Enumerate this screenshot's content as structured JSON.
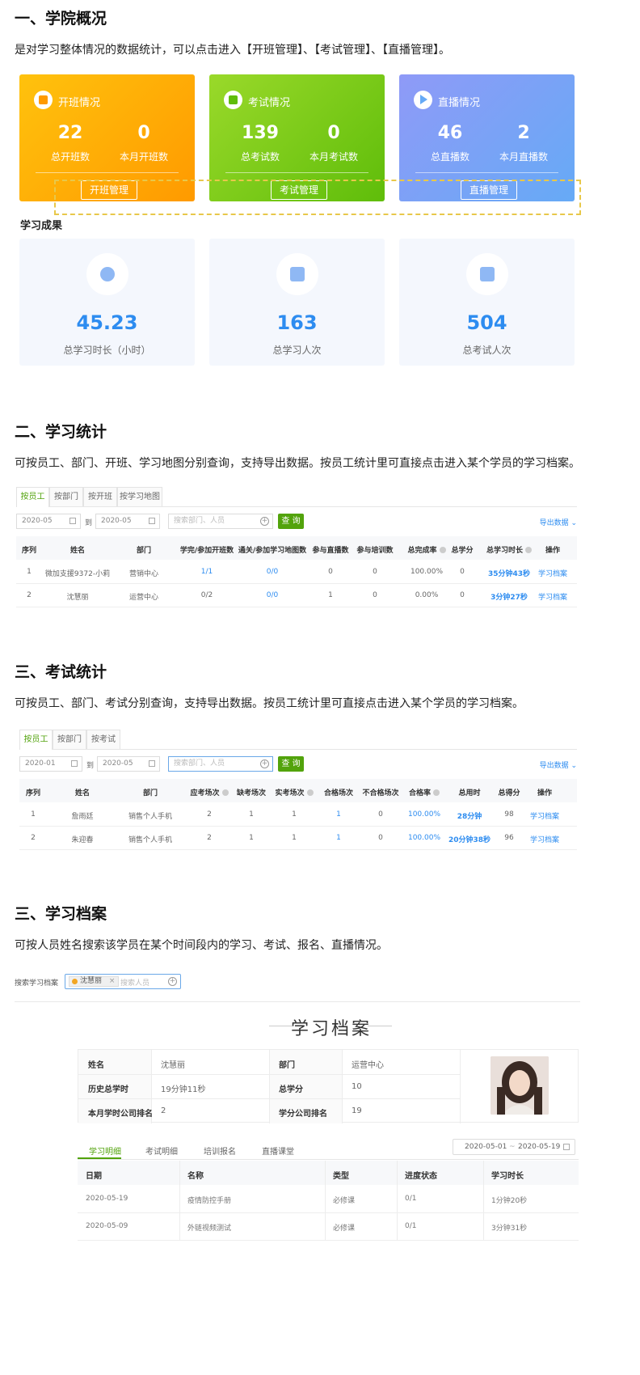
{
  "section1": {
    "heading": "一、学院概况",
    "description": "是对学习整体情况的数据统计，可以点击进入【开班管理】、【考试管理】、【直播管理】。",
    "cards": [
      {
        "title": "开班情况",
        "stats": [
          {
            "value": "22",
            "label": "总开班数"
          },
          {
            "value": "0",
            "label": "本月开班数"
          }
        ],
        "button": "开班管理",
        "color_from": "#ffc20d",
        "color_to": "#ff9a00"
      },
      {
        "title": "考试情况",
        "stats": [
          {
            "value": "139",
            "label": "总考试数"
          },
          {
            "value": "0",
            "label": "本月考试数"
          }
        ],
        "button": "考试管理",
        "color_from": "#9ad92a",
        "color_to": "#5fbd0a"
      },
      {
        "title": "直播情况",
        "stats": [
          {
            "value": "46",
            "label": "总直播数"
          },
          {
            "value": "2",
            "label": "本月直播数"
          }
        ],
        "button": "直播管理",
        "color_from": "#8f9af7",
        "color_to": "#66aaf6"
      }
    ],
    "results_title": "学习成果",
    "results": [
      {
        "value": "45.23",
        "label": "总学习时长（小时）",
        "icon": "clock-icon"
      },
      {
        "value": "163",
        "label": "总学习人次",
        "icon": "id-card-icon"
      },
      {
        "value": "504",
        "label": "总考试人次",
        "icon": "checklist-icon"
      }
    ]
  },
  "section2": {
    "heading": "二、学习统计",
    "description": "可按员工、部门、开班、学习地图分别查询，支持导出数据。按员工统计里可直接点击进入某个学员的学习档案。",
    "tabs": [
      "按员工",
      "按部门",
      "按开班",
      "按学习地图"
    ],
    "date_from": "2020-05",
    "date_to": "2020-05",
    "to_label": "到",
    "search_placeholder": "搜索部门、人员",
    "query": "查 询",
    "export": "导出数据",
    "columns": [
      "序列",
      "姓名",
      "部门",
      "学完/参加开班数",
      "通关/参加学习地图数",
      "参与直播数",
      "参与培训数",
      "总完成率",
      "总学分",
      "总学习时长",
      "操作"
    ],
    "rows": [
      [
        "1",
        "微加支援9372-小莉",
        "营销中心",
        "1/1",
        "0/0",
        "0",
        "0",
        "100.00%",
        "0",
        "35分钟43秒",
        "学习档案"
      ],
      [
        "2",
        "沈慧丽",
        "运营中心",
        "0/2",
        "0/0",
        "1",
        "0",
        "0.00%",
        "0",
        "3分钟27秒",
        "学习档案"
      ]
    ]
  },
  "section3": {
    "heading": "三、考试统计",
    "description": "可按员工、部门、考试分别查询，支持导出数据。按员工统计里可直接点击进入某个学员的学习档案。",
    "tabs": [
      "按员工",
      "按部门",
      "按考试"
    ],
    "date_from": "2020-01",
    "date_to": "2020-05",
    "to_label": "到",
    "search_placeholder": "搜索部门、人员",
    "query": "查 询",
    "export": "导出数据",
    "columns": [
      "序列",
      "姓名",
      "部门",
      "应考场次",
      "缺考场次",
      "实考场次",
      "合格场次",
      "不合格场次",
      "合格率",
      "总用时",
      "总得分",
      "操作"
    ],
    "rows": [
      [
        "1",
        "詹雨廷",
        "销售个人手机",
        "2",
        "1",
        "1",
        "1",
        "0",
        "100.00%",
        "28分钟",
        "98",
        "学习档案"
      ],
      [
        "2",
        "朱迎春",
        "销售个人手机",
        "2",
        "1",
        "1",
        "1",
        "0",
        "100.00%",
        "20分钟38秒",
        "96",
        "学习档案"
      ]
    ]
  },
  "section4": {
    "heading": "三、学习档案",
    "description": "可按人员姓名搜索该学员在某个时间段内的学习、考试、报名、直播情况。",
    "search_label": "搜索学习档案",
    "selected_person": "沈慧丽",
    "search_placeholder": "搜索人员",
    "record_title": "学习档案",
    "info": {
      "name_label": "姓名",
      "name": "沈慧丽",
      "dept_label": "部门",
      "dept": "运营中心",
      "hist_label": "历史总学时",
      "hist": "19分钟11秒",
      "credit_label": "总学分",
      "credit": "10",
      "month_rank_label": "本月学时公司排名",
      "month_rank": "2",
      "credit_rank_label": "学分公司排名",
      "credit_rank": "19"
    },
    "tabs": [
      "学习明细",
      "考试明细",
      "培训报名",
      "直播课堂"
    ],
    "date_from": "2020-05-01",
    "date_sep": "~",
    "date_to": "2020-05-19",
    "columns": [
      "日期",
      "名称",
      "类型",
      "进度状态",
      "学习时长"
    ],
    "rows": [
      [
        "2020-05-19",
        "疫情防控手册",
        "必修课",
        "0/1",
        "1分钟20秒"
      ],
      [
        "2020-05-09",
        "外链视频测试",
        "必修课",
        "0/1",
        "3分钟31秒"
      ]
    ]
  }
}
